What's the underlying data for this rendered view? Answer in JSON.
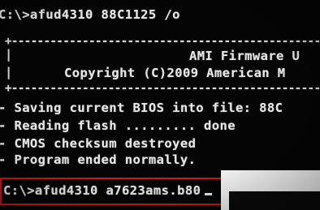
{
  "terminal": {
    "cmd1": "C:\\>afud4310 88C1125 /o",
    "sep_top": "+---------------------------------------------------------",
    "edge_bar": "|",
    "title": "AMI Firmware U",
    "copyright": "Copyright (C)2009 American M",
    "sep_bottom": "+---------------------------------------------------------",
    "status": [
      "- Saving current BIOS into file: 88C",
      "- Reading flash ......... done",
      "- CMOS checksum destroyed",
      "- Program ended normally."
    ],
    "cmd2": "C:\\>afud4310 a7623ams.b80"
  }
}
